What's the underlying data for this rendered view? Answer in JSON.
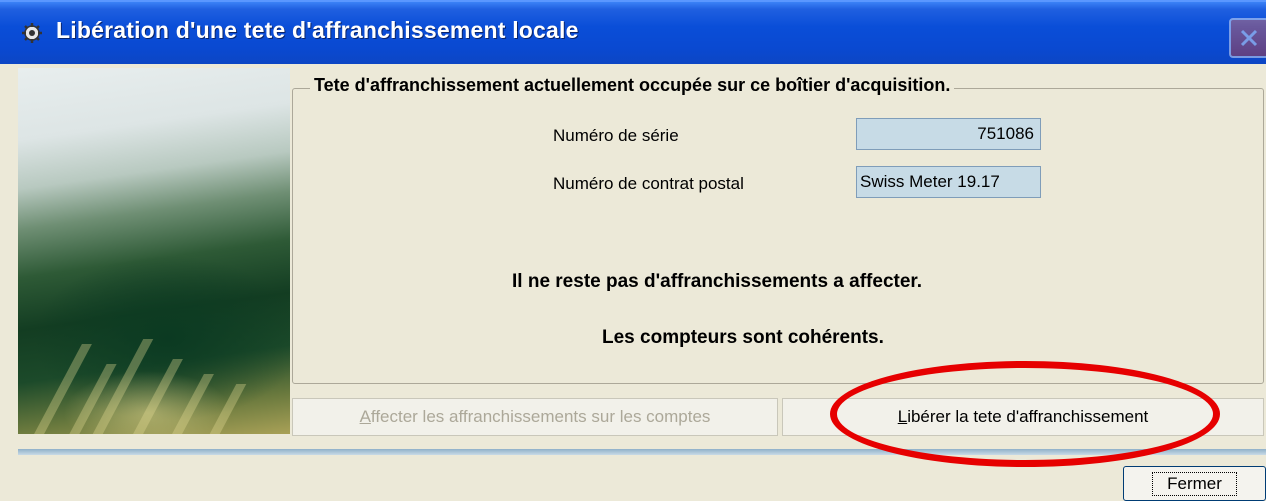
{
  "window": {
    "title": "Libération d'une tete d'affranchissement locale",
    "app_icon": "gear-icon",
    "close_icon": "close-icon"
  },
  "group": {
    "legend": "Tete d'affranchissement actuellement occupée sur ce boîtier d'acquisition.",
    "serial_label": "Numéro de série",
    "serial_value": "751086",
    "contract_label": "Numéro de contrat postal",
    "contract_value": "Swiss Meter 19.17",
    "message_remaining": "Il ne reste pas d'affranchissements a affecter.",
    "message_counters": "Les compteurs sont cohérents."
  },
  "buttons": {
    "assign_first": "A",
    "assign_rest": "ffecter les affranchissements sur les comptes",
    "release_first": "L",
    "release_rest": "ibérer la tete d'affranchissement",
    "close": "Fermer"
  },
  "colors": {
    "titlebar": "#0a4ed8",
    "dialog_bg": "#ece9d8",
    "field_bg": "#c7dbe6",
    "highlight": "#e60000",
    "disabled_text": "#aca899"
  }
}
